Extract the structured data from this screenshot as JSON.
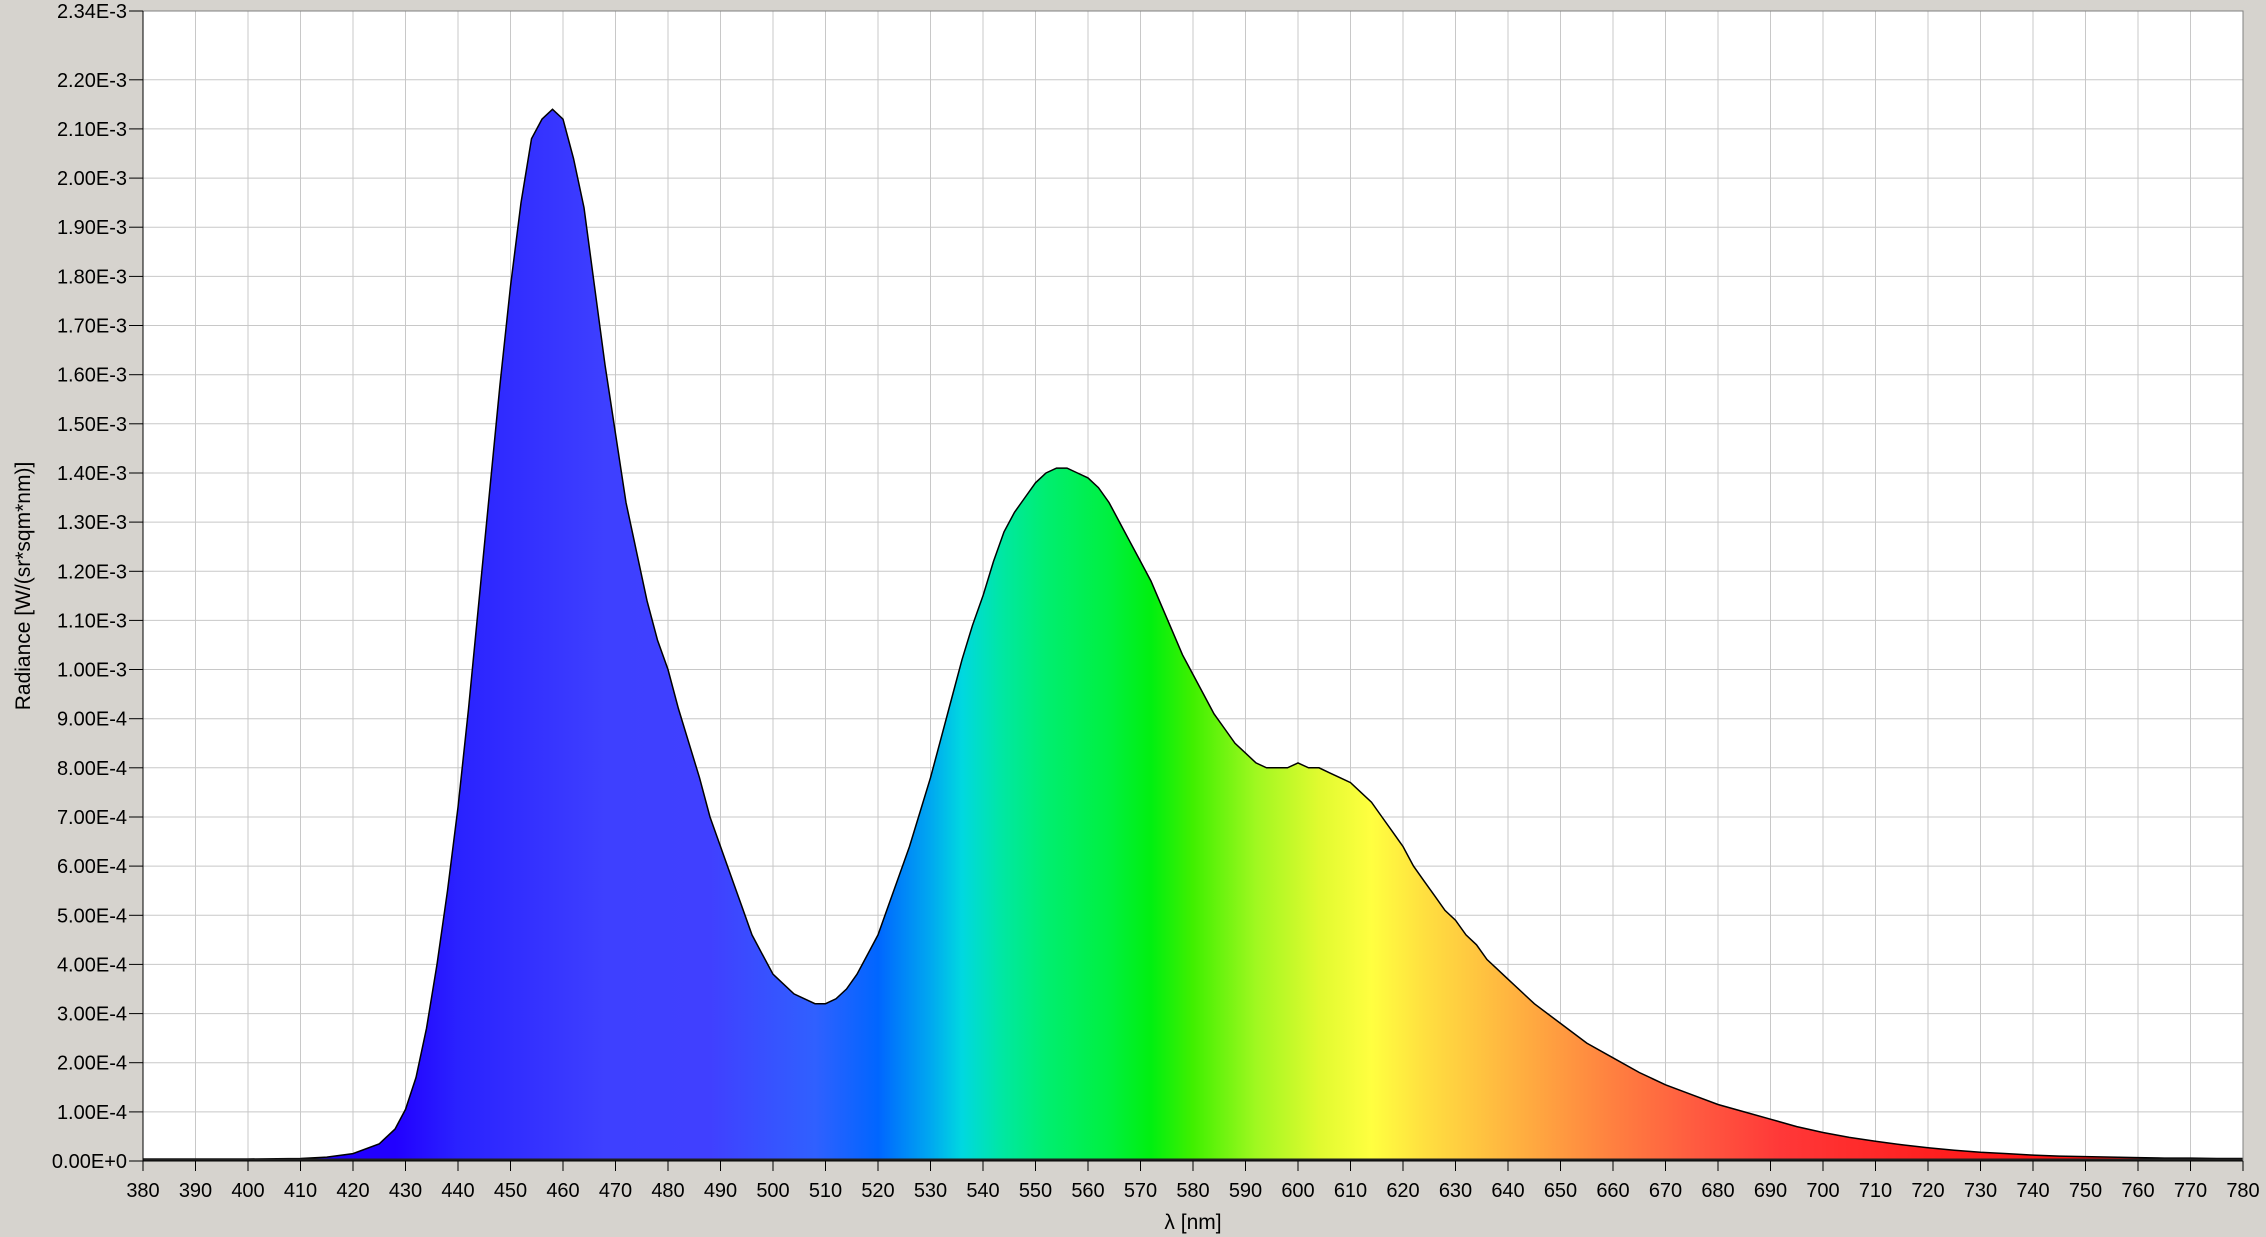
{
  "chart_data": {
    "type": "area",
    "title": "",
    "xlabel": "λ [nm]",
    "ylabel": "Radiance [W/(sr*sqm*nm)]",
    "xlim": [
      380,
      780
    ],
    "ylim": [
      0,
      0.00234
    ],
    "grid": true,
    "legend": "none",
    "x_ticks": [
      380,
      390,
      400,
      410,
      420,
      430,
      440,
      450,
      460,
      470,
      480,
      490,
      500,
      510,
      520,
      530,
      540,
      550,
      560,
      570,
      580,
      590,
      600,
      610,
      620,
      630,
      640,
      650,
      660,
      670,
      680,
      690,
      700,
      710,
      720,
      730,
      740,
      750,
      760,
      770,
      780
    ],
    "x_tick_labels": [
      "380",
      "390",
      "400",
      "410",
      "420",
      "430",
      "440",
      "450",
      "460",
      "470",
      "480",
      "490",
      "500",
      "510",
      "520",
      "530",
      "540",
      "550",
      "560",
      "570",
      "580",
      "590",
      "600",
      "610",
      "620",
      "630",
      "640",
      "650",
      "660",
      "670",
      "680",
      "690",
      "700",
      "710",
      "720",
      "730",
      "740",
      "750",
      "760",
      "770",
      "780"
    ],
    "y_ticks": [
      0,
      0.0001,
      0.0002,
      0.0003,
      0.0004,
      0.0005,
      0.0006,
      0.0007,
      0.0008,
      0.0009,
      0.001,
      0.0011,
      0.0012,
      0.0013,
      0.0014,
      0.0015,
      0.0016,
      0.0017,
      0.0018,
      0.0019,
      0.002,
      0.0021,
      0.0022,
      0.00234
    ],
    "y_tick_labels": [
      "0.00E+0",
      "1.00E-4",
      "2.00E-4",
      "3.00E-4",
      "4.00E-4",
      "5.00E-4",
      "6.00E-4",
      "7.00E-4",
      "8.00E-4",
      "9.00E-4",
      "1.00E-3",
      "1.10E-3",
      "1.20E-3",
      "1.30E-3",
      "1.40E-3",
      "1.50E-3",
      "1.60E-3",
      "1.70E-3",
      "1.80E-3",
      "1.90E-3",
      "2.00E-3",
      "2.10E-3",
      "2.20E-3",
      "2.34E-3"
    ],
    "series": [
      {
        "x": [
          380,
          390,
          400,
          410,
          415,
          420,
          425,
          428,
          430,
          432,
          434,
          436,
          438,
          440,
          442,
          444,
          446,
          448,
          450,
          452,
          454,
          456,
          458,
          460,
          462,
          464,
          466,
          468,
          470,
          472,
          474,
          476,
          478,
          480,
          482,
          484,
          486,
          488,
          490,
          492,
          494,
          496,
          498,
          500,
          502,
          504,
          506,
          508,
          510,
          512,
          514,
          516,
          518,
          520,
          522,
          524,
          526,
          528,
          530,
          532,
          534,
          536,
          538,
          540,
          542,
          544,
          546,
          548,
          550,
          552,
          554,
          556,
          558,
          560,
          562,
          564,
          566,
          568,
          570,
          572,
          574,
          576,
          578,
          580,
          582,
          584,
          586,
          588,
          590,
          592,
          594,
          596,
          598,
          600,
          602,
          604,
          606,
          608,
          610,
          612,
          614,
          616,
          618,
          620,
          622,
          624,
          626,
          628,
          630,
          632,
          634,
          636,
          638,
          640,
          645,
          650,
          655,
          660,
          665,
          670,
          675,
          680,
          685,
          690,
          695,
          700,
          705,
          710,
          715,
          720,
          725,
          730,
          735,
          740,
          745,
          750,
          755,
          760,
          765,
          770,
          775,
          780
        ],
        "y": [
          4e-06,
          4e-06,
          4e-06,
          5e-06,
          8e-06,
          1.5e-05,
          3.5e-05,
          6.5e-05,
          0.000105,
          0.00017,
          0.00027,
          0.0004,
          0.00055,
          0.00072,
          0.00092,
          0.00114,
          0.00136,
          0.00158,
          0.00178,
          0.00195,
          0.00208,
          0.00212,
          0.00214,
          0.00212,
          0.00204,
          0.00194,
          0.00178,
          0.00162,
          0.00148,
          0.00134,
          0.00124,
          0.00114,
          0.00106,
          0.001,
          0.00092,
          0.00085,
          0.00078,
          0.0007,
          0.00064,
          0.00058,
          0.00052,
          0.00046,
          0.00042,
          0.00038,
          0.00036,
          0.00034,
          0.00033,
          0.00032,
          0.00032,
          0.00033,
          0.00035,
          0.00038,
          0.00042,
          0.00046,
          0.00052,
          0.00058,
          0.00064,
          0.00071,
          0.00078,
          0.00086,
          0.00094,
          0.00102,
          0.00109,
          0.00115,
          0.00122,
          0.00128,
          0.00132,
          0.00135,
          0.00138,
          0.0014,
          0.00141,
          0.00141,
          0.0014,
          0.00139,
          0.00137,
          0.00134,
          0.0013,
          0.00126,
          0.00122,
          0.00118,
          0.00113,
          0.00108,
          0.00103,
          0.00099,
          0.00095,
          0.00091,
          0.00088,
          0.00085,
          0.00083,
          0.00081,
          0.0008,
          0.0008,
          0.0008,
          0.00081,
          0.0008,
          0.0008,
          0.00079,
          0.00078,
          0.00077,
          0.00075,
          0.00073,
          0.0007,
          0.00067,
          0.00064,
          0.0006,
          0.00057,
          0.00054,
          0.00051,
          0.00049,
          0.00046,
          0.00044,
          0.00041,
          0.00039,
          0.00037,
          0.00032,
          0.00028,
          0.00024,
          0.00021,
          0.00018,
          0.000155,
          0.000135,
          0.000115,
          0.0001,
          8.5e-05,
          7e-05,
          5.8e-05,
          4.8e-05,
          4e-05,
          3.3e-05,
          2.7e-05,
          2.2e-05,
          1.8e-05,
          1.5e-05,
          1.2e-05,
          1e-05,
          9e-06,
          8e-06,
          7e-06,
          6e-06,
          6e-06,
          5e-06,
          5e-06
        ]
      }
    ],
    "colors": {
      "background": "#ffffff",
      "frame": "#d6d3ce",
      "grid": "#c8c8c8",
      "outline": "#000000"
    },
    "fill": "visible-spectrum gradient by wavelength"
  }
}
